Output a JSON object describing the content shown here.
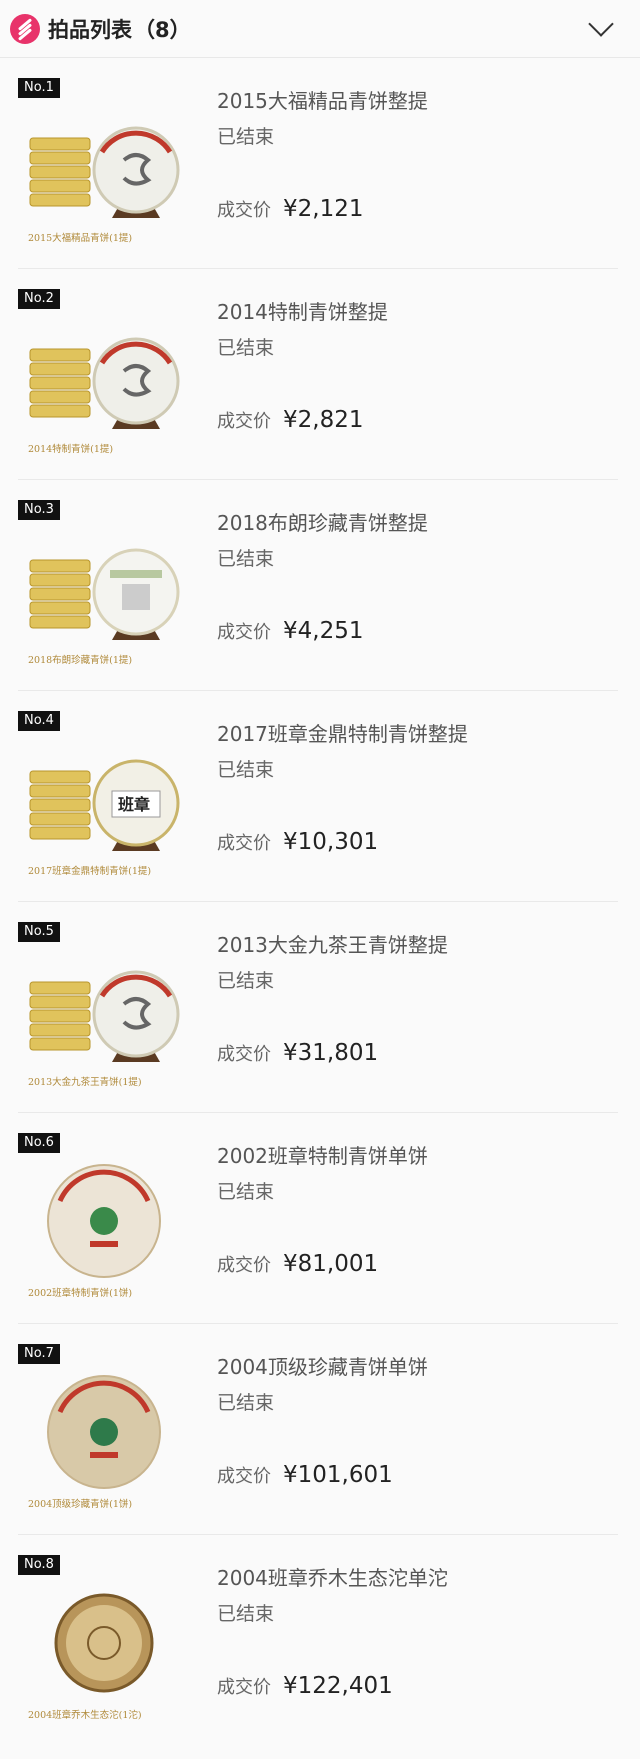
{
  "header": {
    "title": "拍品列表",
    "count": "（8）"
  },
  "labels": {
    "status": "已结束",
    "price_label": "成交价"
  },
  "items": [
    {
      "no": "No.1",
      "name": "2015大福精品青饼整提",
      "price": "¥2,121",
      "caption": "2015大福精品青饼(1提)",
      "type": "stack",
      "seal": "a"
    },
    {
      "no": "No.2",
      "name": "2014特制青饼整提",
      "price": "¥2,821",
      "caption": "2014特制青饼(1提)",
      "type": "stack",
      "seal": "a"
    },
    {
      "no": "No.3",
      "name": "2018布朗珍藏青饼整提",
      "price": "¥4,251",
      "caption": "2018布朗珍藏青饼(1提)",
      "type": "stack",
      "seal": "b"
    },
    {
      "no": "No.4",
      "name": "2017班章金鼎特制青饼整提",
      "price": "¥10,301",
      "caption": "2017班章金鼎特制青饼(1提)",
      "type": "stack",
      "seal": "c",
      "seal_text": "班章"
    },
    {
      "no": "No.5",
      "name": "2013大金九茶王青饼整提",
      "price": "¥31,801",
      "caption": "2013大金九茶王青饼(1提)",
      "type": "stack",
      "seal": "a"
    },
    {
      "no": "No.6",
      "name": "2002班章特制青饼单饼",
      "price": "¥81,001",
      "caption": "2002班章特制青饼(1饼)",
      "type": "single",
      "seal": "d"
    },
    {
      "no": "No.7",
      "name": "2004顶级珍藏青饼单饼",
      "price": "¥101,601",
      "caption": "2004顶级珍藏青饼(1饼)",
      "type": "single",
      "seal": "e"
    },
    {
      "no": "No.8",
      "name": "2004班章乔木生态沱单沱",
      "price": "¥122,401",
      "caption": "2004班章乔木生态沱(1沱)",
      "type": "tuo",
      "seal": "f"
    }
  ]
}
